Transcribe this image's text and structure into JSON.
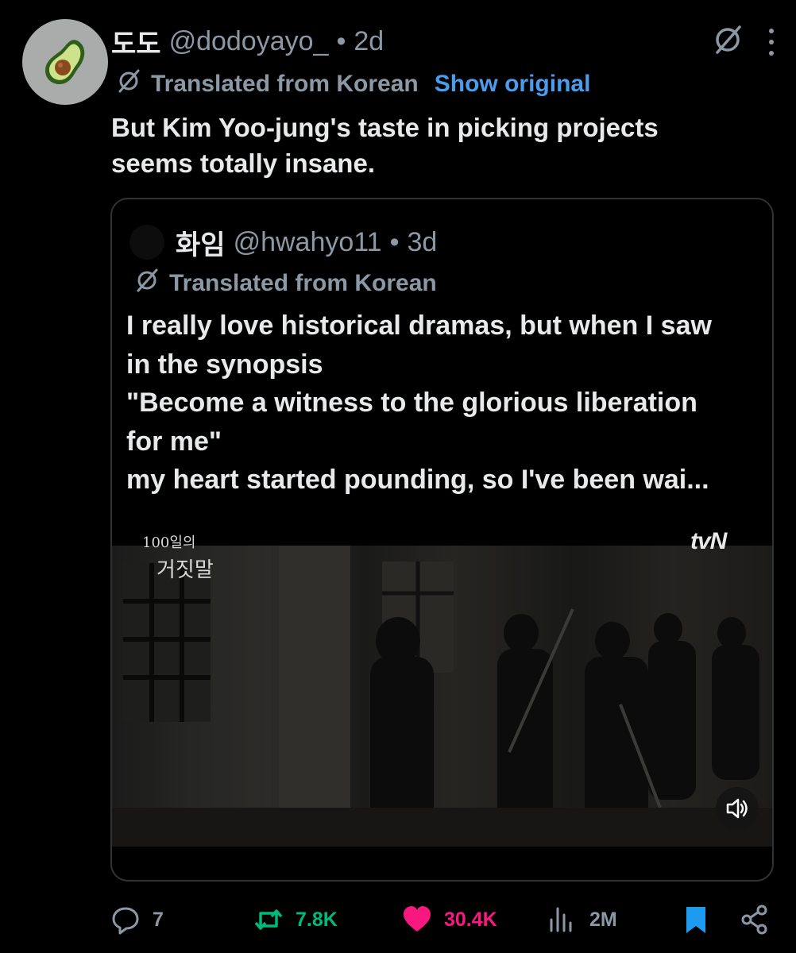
{
  "tweet": {
    "display_name": "도도",
    "handle": "@dodoyayo_",
    "separator": "•",
    "time": "2d",
    "translated_label": "Translated from Korean",
    "show_original": "Show original",
    "text_lines": [
      "But Kim Yoo-jung's taste in picking projects",
      "seems totally insane."
    ]
  },
  "quote": {
    "display_name": "화임",
    "handle": "@hwahyo11",
    "separator": "•",
    "time": "3d",
    "translated_label": "Translated from Korean",
    "text_lines": [
      "I really love historical dramas, but when I saw",
      "in the synopsis",
      "\"Become a witness to the glorious liberation",
      "for me\"",
      "my heart started pounding, so I've been wai..."
    ],
    "video": {
      "title_line1": "100일의",
      "title_line2": "거짓말",
      "channel_logo": "tvN"
    }
  },
  "actions": {
    "replies": "7",
    "reposts": "7.8K",
    "likes": "30.4K",
    "views": "2M"
  },
  "icons": {
    "avatar": "avocado-icon",
    "grok": "grok-icon",
    "more": "more-dots-icon",
    "translate": "translate-icon",
    "reply": "reply-icon",
    "repost": "repost-icon",
    "like": "heart-icon",
    "views": "views-icon",
    "bookmark": "bookmark-icon",
    "share": "share-icon",
    "mute": "speaker-mute-icon"
  },
  "colors": {
    "background": "#000000",
    "text_primary": "#e7e9ea",
    "text_secondary": "#8b98a5",
    "link": "#4a9ded",
    "repost_active": "#00ba7c",
    "like_active": "#f91880",
    "bookmark_active": "#1d9bf0",
    "card_border": "#2f3336"
  }
}
